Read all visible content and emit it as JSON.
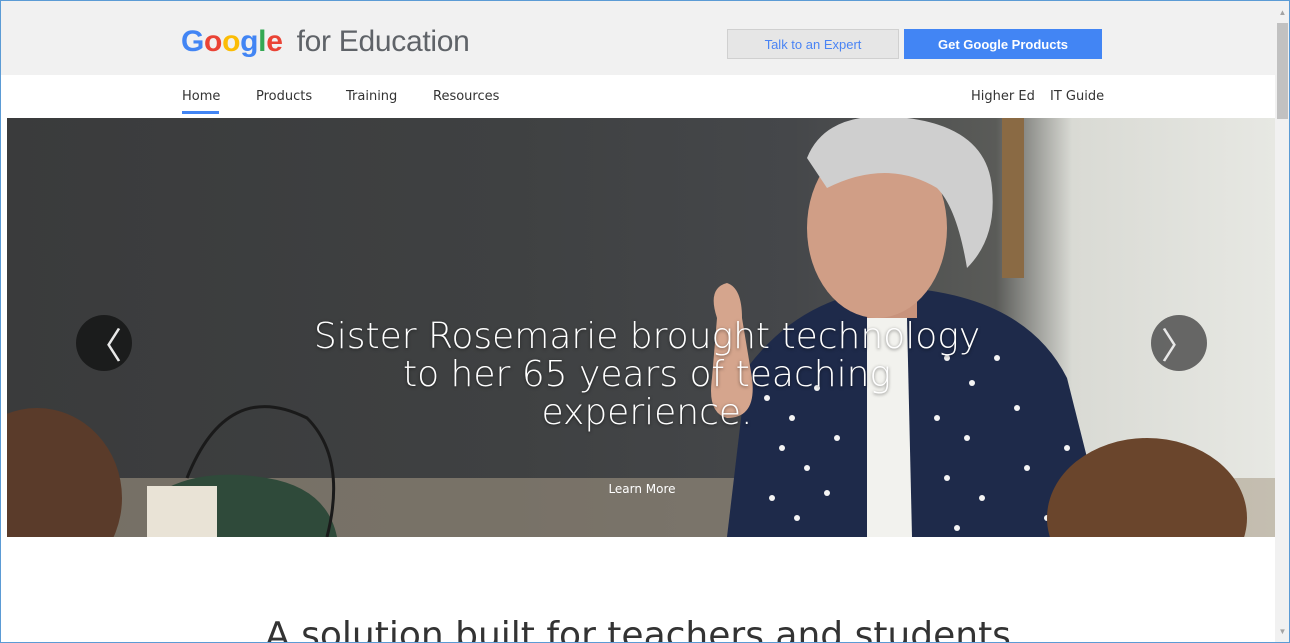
{
  "header": {
    "logo_google": "Google",
    "logo_rest": "for Education",
    "talk_expert": "Talk to an Expert",
    "get_products": "Get Google Products"
  },
  "nav": {
    "items": [
      "Home",
      "Products",
      "Training",
      "Resources"
    ],
    "right_items": [
      "Higher Ed",
      "IT Guide"
    ],
    "active": "Home"
  },
  "hero": {
    "caption_line1": "Sister Rosemarie brought technology",
    "caption_line2": "to her 65 years of teaching",
    "caption_line3": "experience.",
    "learn_more": "Learn More",
    "prev_icon": "chevron-left-icon",
    "next_icon": "chevron-right-icon",
    "prev_glyph": "〈",
    "next_glyph": "〉"
  },
  "main": {
    "headline": "A solution built for teachers and students"
  },
  "colors": {
    "accent": "#4285f4",
    "google_blue": "#4285f4",
    "google_red": "#ea4335",
    "google_yellow": "#fbbc05",
    "google_green": "#34a853"
  }
}
